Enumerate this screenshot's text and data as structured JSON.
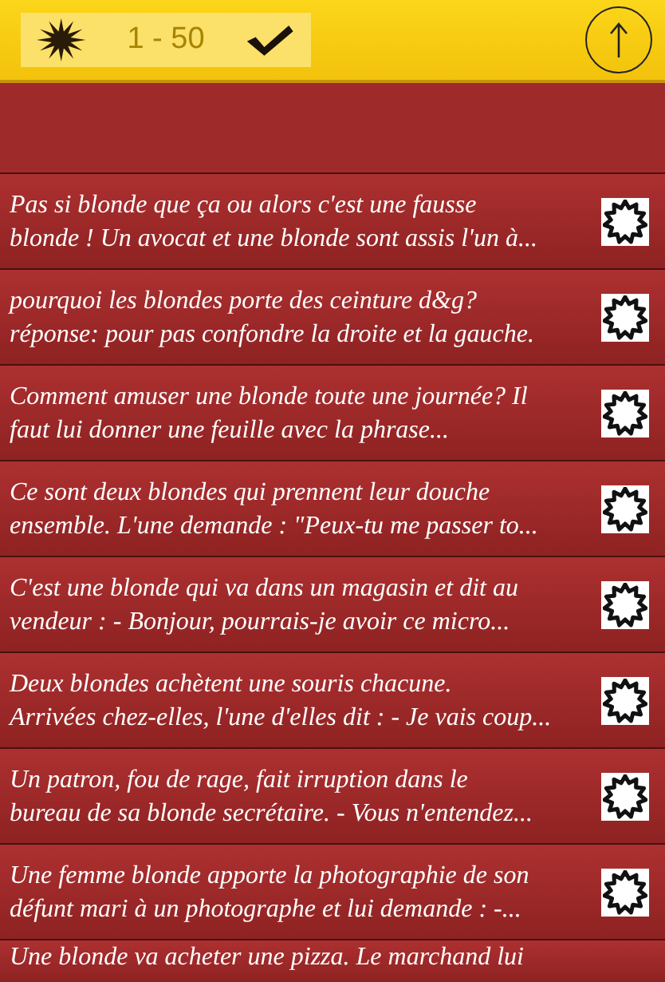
{
  "toolbar": {
    "range": "1 - 50"
  },
  "items": [
    {
      "lines": [
        "Pas si blonde que ça ou alors c'est une fausse",
        "blonde ! Un avocat et une blonde sont assis l'un à..."
      ]
    },
    {
      "lines": [
        "pourquoi les blondes porte des ceinture d&g?",
        "réponse: pour pas confondre la droite et la gauche."
      ]
    },
    {
      "lines": [
        "Comment amuser une blonde toute une journée? Il",
        "faut lui donner une feuille avec la phrase..."
      ]
    },
    {
      "lines": [
        "Ce sont deux blondes qui prennent leur douche",
        "ensemble. L'une demande : \"Peux-tu me passer to..."
      ]
    },
    {
      "lines": [
        "C'est une blonde qui va dans un magasin et dit au",
        "vendeur : - Bonjour, pourrais-je avoir ce micro..."
      ]
    },
    {
      "lines": [
        "Deux blondes achètent une souris chacune.",
        "Arrivées chez-elles, l'une d'elles dit : - Je vais coup..."
      ]
    },
    {
      "lines": [
        "Un patron, fou de rage, fait irruption dans le",
        "bureau de sa blonde secrétaire. - Vous n'entendez..."
      ]
    },
    {
      "lines": [
        "Une femme blonde apporte la photographie de son",
        "défunt mari à un photographe et lui demande : -..."
      ]
    },
    {
      "lines": [
        "Une blonde va acheter une pizza. Le marchand lui"
      ]
    }
  ]
}
